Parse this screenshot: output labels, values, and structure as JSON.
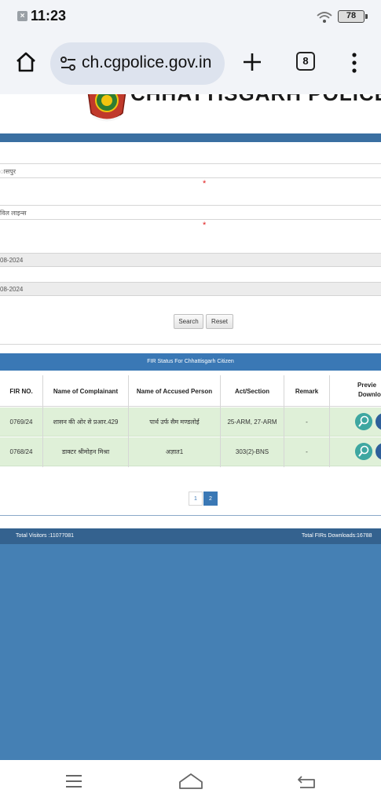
{
  "status_bar": {
    "time": "11:23",
    "notification_icon": "x-icon",
    "battery": "78"
  },
  "browser": {
    "url": "ch.cgpolice.gov.in",
    "tab_count": "8",
    "icons": [
      "home-icon",
      "tune-icon",
      "plus-icon",
      "tabs-icon",
      "more-vert-icon"
    ]
  },
  "site": {
    "title": "CHHATTISGARH POLICE"
  },
  "form": {
    "district_value": "ासपुर",
    "police_station_value": "विल लाइन्स",
    "required_mark": "*",
    "from_date": "08-2024",
    "to_date": "08-2024",
    "search_label": "Search",
    "reset_label": "Reset"
  },
  "fir": {
    "banner": "FIR Status For Chhattisgarh Citizen",
    "columns": {
      "fir_no": "FIR NO.",
      "complainant": "Name of Complainant",
      "accused": "Name of Accused Person",
      "act": "Act/Section",
      "remark": "Remark",
      "preview": "Previe",
      "download": "Downlo"
    },
    "rows": [
      {
        "fir_no": "0769/24",
        "complainant": "शासन की ओर से प्रआर.429",
        "accused": "पार्थ उर्फ सैम मण्डलोई",
        "act": "25-ARM, 27-ARM",
        "remark": "-"
      },
      {
        "fir_no": "0768/24",
        "complainant": "डाक्टर श्रीमोहन मिश्रा",
        "accused": "अज्ञात1",
        "act": "303(2)-BNS",
        "remark": "-"
      }
    ]
  },
  "pagination": {
    "page1": "1",
    "page2": "2",
    "current": "2"
  },
  "footer": {
    "total_visitors": "Total Visitors :11077081",
    "total_downloads": "Total FIRs Downloads:16788"
  },
  "colors": {
    "header_blue": "#3a6fa1",
    "banner_blue": "#3a78b5",
    "row_green": "#dff0d8",
    "footer_blue": "#4580b4"
  }
}
